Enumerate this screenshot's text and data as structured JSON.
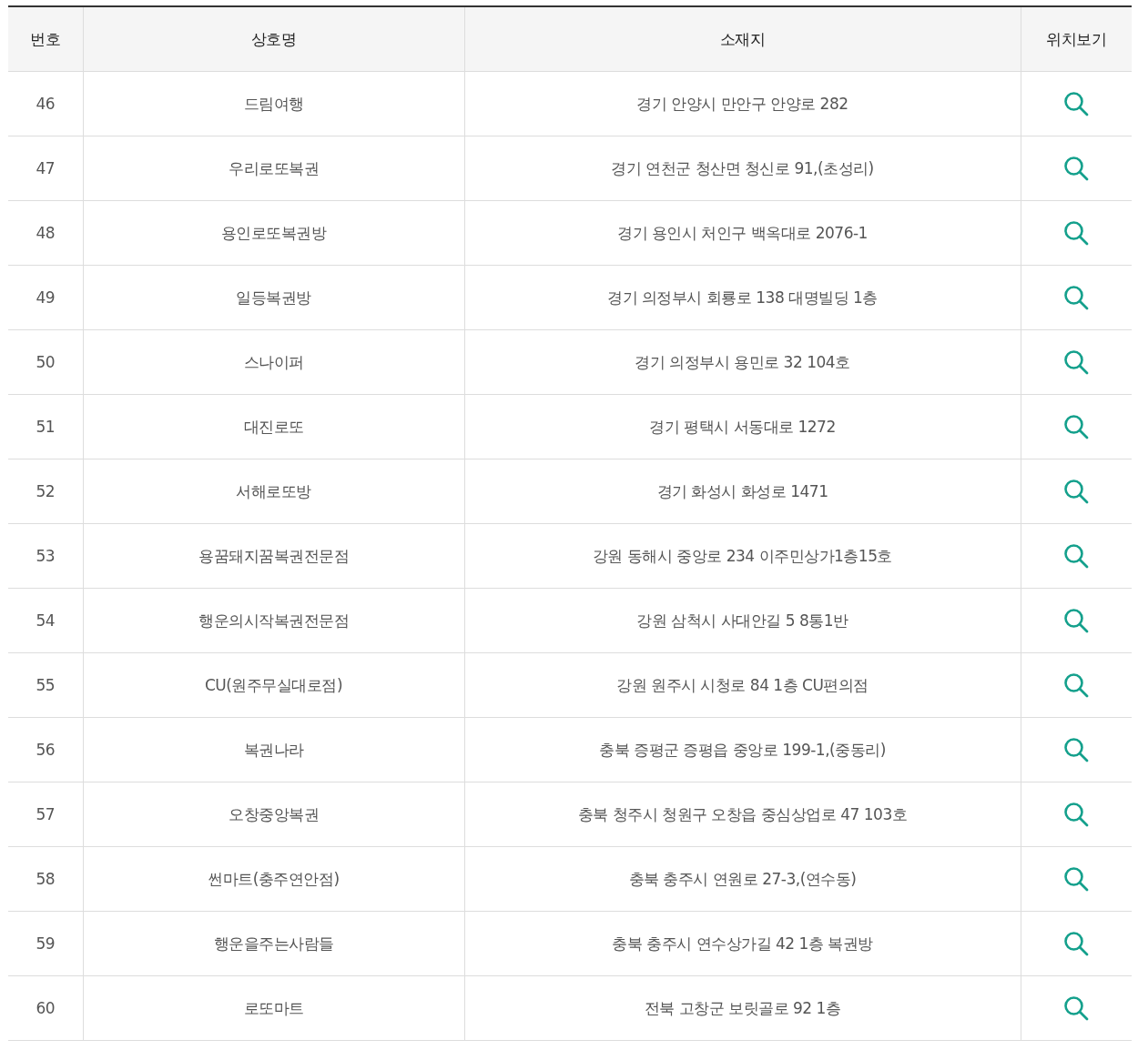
{
  "table": {
    "columns": [
      "번호",
      "상호명",
      "소재지",
      "위치보기"
    ],
    "rows": [
      {
        "number": "46",
        "name": "드림여행",
        "address": "경기 안양시 만안구 안양로 282"
      },
      {
        "number": "47",
        "name": "우리로또복권",
        "address": "경기 연천군 청산면 청신로 91,(초성리)"
      },
      {
        "number": "48",
        "name": "용인로또복권방",
        "address": "경기 용인시 처인구 백옥대로 2076-1"
      },
      {
        "number": "49",
        "name": "일등복권방",
        "address": "경기 의정부시 회룡로 138 대명빌딩 1층"
      },
      {
        "number": "50",
        "name": "스나이퍼",
        "address": "경기 의정부시 용민로 32 104호"
      },
      {
        "number": "51",
        "name": "대진로또",
        "address": "경기 평택시 서동대로 1272"
      },
      {
        "number": "52",
        "name": "서해로또방",
        "address": "경기 화성시 화성로 1471"
      },
      {
        "number": "53",
        "name": "용꿈돼지꿈복권전문점",
        "address": "강원 동해시 중앙로 234 이주민상가1층15호"
      },
      {
        "number": "54",
        "name": "행운의시작복권전문점",
        "address": "강원 삼척시 사대안길 5 8통1반"
      },
      {
        "number": "55",
        "name": "CU(원주무실대로점)",
        "address": "강원 원주시 시청로 84 1층 CU편의점"
      },
      {
        "number": "56",
        "name": "복권나라",
        "address": "충북 증평군 증평읍 중앙로 199-1,(중동리)"
      },
      {
        "number": "57",
        "name": "오창중앙복권",
        "address": "충북 청주시 청원구 오창읍 중심상업로 47 103호"
      },
      {
        "number": "58",
        "name": "썬마트(충주연안점)",
        "address": "충북 충주시 연원로 27-3,(연수동)"
      },
      {
        "number": "59",
        "name": "행운을주는사람들",
        "address": "충북 충주시 연수상가길 42 1층 복권방"
      },
      {
        "number": "60",
        "name": "로또마트",
        "address": "전북 고창군 보릿골로 92 1층"
      }
    ]
  }
}
